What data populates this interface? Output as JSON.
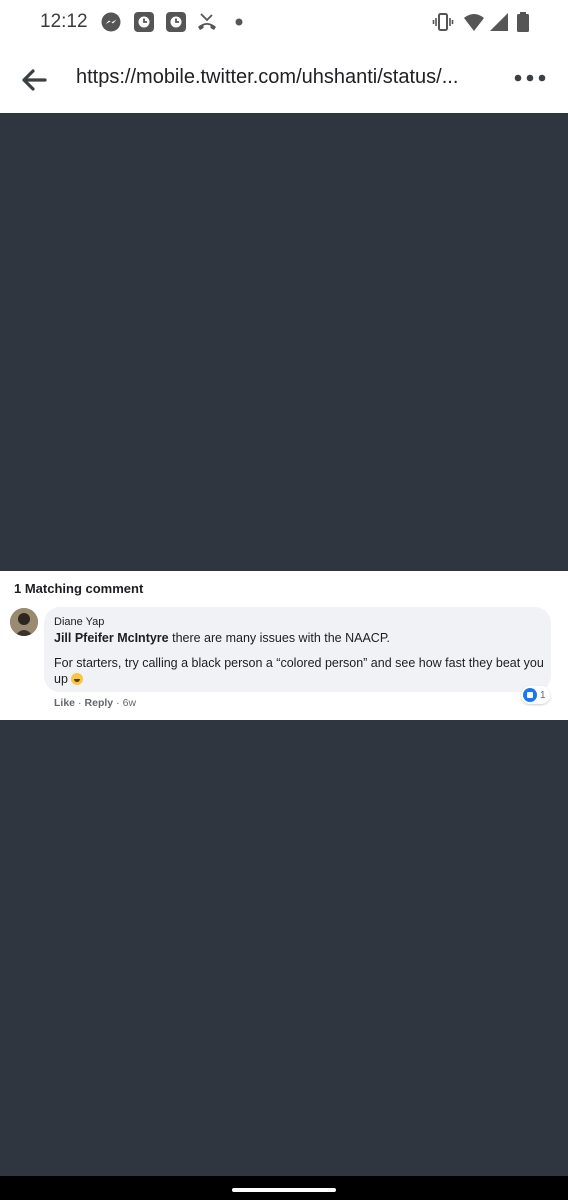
{
  "status_bar": {
    "time": "12:12",
    "left_icons": [
      "messenger-icon",
      "app-icon",
      "app-icon",
      "missed-call-icon",
      "notification-dot-icon"
    ],
    "right_icons": [
      "vibrate-icon",
      "wifi-icon",
      "signal-icon",
      "battery-icon"
    ]
  },
  "browser": {
    "url": "https://mobile.twitter.com/uhshanti/status/..."
  },
  "comment_card": {
    "heading": "1 Matching comment",
    "author": "Diane Yap",
    "mention": "Jill Pfeifer McIntyre",
    "line1_rest": " there are many issues with the NAACP.",
    "line2": "For starters, try calling a black person a “colored person” and see how fast they beat you up",
    "reaction_count": "1",
    "actions": {
      "like": "Like",
      "reply": "Reply",
      "time": "6w",
      "separator": "·"
    }
  },
  "colors": {
    "page_background": "#30363f",
    "accent": "#1877f2"
  }
}
